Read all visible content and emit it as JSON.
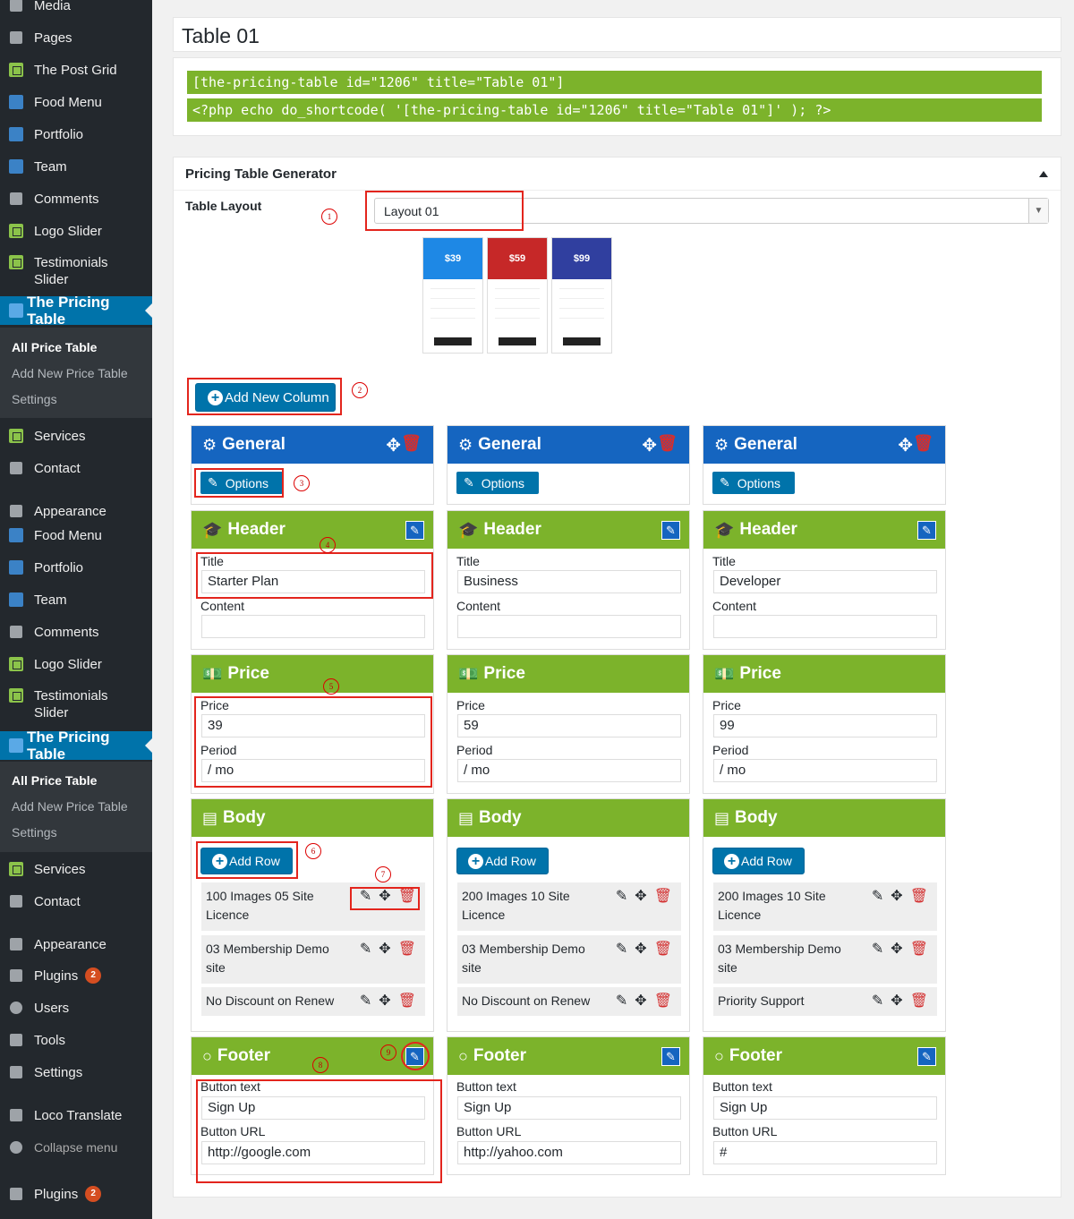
{
  "sidebar": {
    "items_top": [
      {
        "label": "Media",
        "icon": "media-icon"
      },
      {
        "label": "Pages",
        "icon": "pages-icon"
      },
      {
        "label": "The Post Grid",
        "icon": "grid-icon"
      },
      {
        "label": "Food Menu",
        "icon": "food-menu-icon"
      },
      {
        "label": "Portfolio",
        "icon": "portfolio-icon"
      },
      {
        "label": "Team",
        "icon": "team-icon"
      },
      {
        "label": "Comments",
        "icon": "comments-icon"
      },
      {
        "label": "Logo Slider",
        "icon": "logo-slider-icon"
      },
      {
        "label": "Testimonials Slider",
        "icon": "testimonials-icon"
      }
    ],
    "active_label": "The Pricing Table",
    "sub_items": [
      "All Price Table",
      "Add New Price Table",
      "Settings"
    ],
    "items_after": [
      {
        "label": "Services"
      },
      {
        "label": "Contact"
      }
    ],
    "items_mid": [
      {
        "label": "Appearance"
      },
      {
        "label": "Food Menu"
      },
      {
        "label": "Portfolio"
      },
      {
        "label": "Team"
      },
      {
        "label": "Comments"
      },
      {
        "label": "Logo Slider"
      },
      {
        "label": "Testimonials Slider"
      }
    ],
    "items_bottom": [
      {
        "label": "Appearance"
      },
      {
        "label": "Plugins",
        "badge": "2"
      },
      {
        "label": "Users"
      },
      {
        "label": "Tools"
      },
      {
        "label": "Settings"
      },
      {
        "label": "Loco Translate"
      },
      {
        "label": "Collapse menu"
      },
      {
        "label": "Plugins",
        "badge": "2"
      }
    ]
  },
  "title_box": {
    "title": "Table 01"
  },
  "shortcodes": [
    "[the-pricing-table id=\"1206\" title=\"Table 01\"]",
    "<?php echo do_shortcode( '[the-pricing-table id=\"1206\" title=\"Table 01\"]' ); ?>"
  ],
  "generator": {
    "title": "Pricing Table Generator",
    "layout_label": "Table Layout",
    "layout_value": "Layout 01",
    "add_column_label": "Add New Column",
    "previews": [
      {
        "price": "$39",
        "color": "#1e88e5"
      },
      {
        "price": "$59",
        "color": "#c62828"
      },
      {
        "price": "$99",
        "color": "#303f9f"
      }
    ]
  },
  "annotations": [
    "1",
    "2",
    "3",
    "4",
    "5",
    "6",
    "7",
    "8",
    "9"
  ],
  "labels": {
    "general": "General",
    "options": "Options",
    "header": "Header",
    "title": "Title",
    "content": "Content",
    "price_section": "Price",
    "price": "Price",
    "period": "Period",
    "body": "Body",
    "add_row": "Add Row",
    "footer": "Footer",
    "button_text": "Button text",
    "button_url": "Button URL"
  },
  "columns": [
    {
      "title": "Starter Plan",
      "content": "",
      "price": "39",
      "period": "/ mo",
      "rows": [
        "100 Images 05 Site Licence",
        "03 Membership Demo site",
        "No Discount on Renew"
      ],
      "button_text": "Sign Up",
      "button_url": "http://google.com"
    },
    {
      "title": "Business",
      "content": "",
      "price": "59",
      "period": "/ mo",
      "rows": [
        "200 Images 10 Site Licence",
        "03 Membership Demo site",
        "No Discount on Renew"
      ],
      "button_text": "Sign Up",
      "button_url": "http://yahoo.com"
    },
    {
      "title": "Developer",
      "content": "",
      "price": "99",
      "period": "/ mo",
      "rows": [
        "200 Images 10 Site Licence",
        "03 Membership Demo site",
        "Priority Support"
      ],
      "button_text": "Sign Up",
      "button_url": "#"
    }
  ]
}
